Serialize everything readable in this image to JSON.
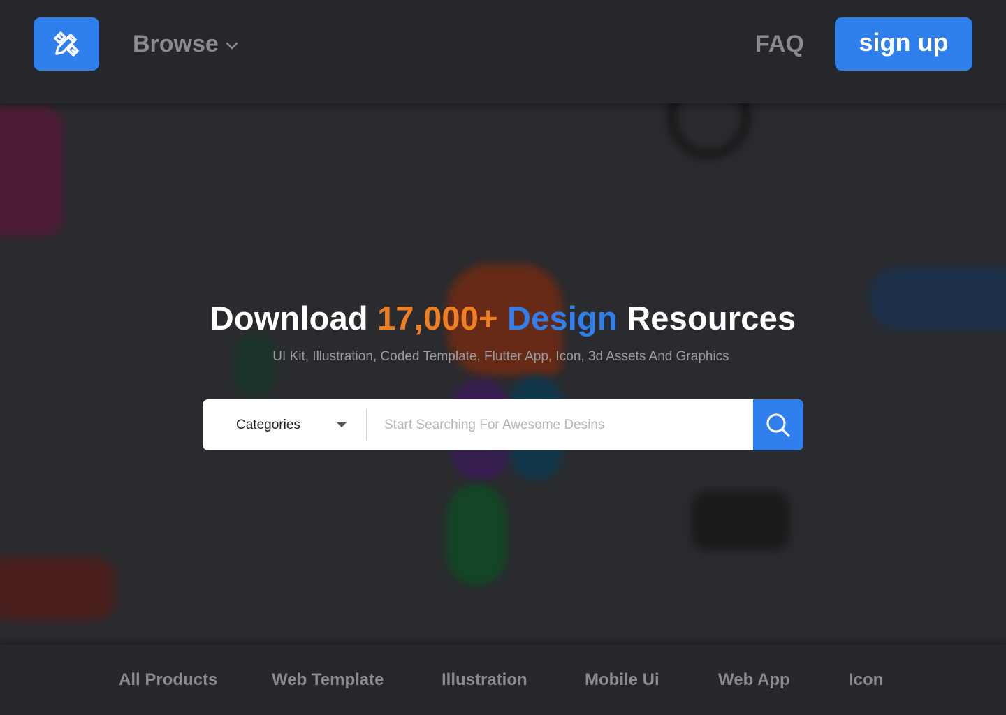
{
  "header": {
    "browse_label": "Browse",
    "faq_label": "FAQ",
    "signup_label": "sign up",
    "logo_icon": "design-tools-icon",
    "accent_color": "#2f80ed"
  },
  "hero": {
    "heading_part1": "Download",
    "heading_count": "17,000+",
    "heading_highlight": "Design",
    "heading_part2": "Resources",
    "subheading": "UI Kit, Illustration, Coded Template, Flutter App, Icon, 3d Assets And Graphics",
    "count_color": "#f07e22",
    "highlight_color": "#2f80ed"
  },
  "search": {
    "category_label": "Categories",
    "placeholder": "Start Searching For Awesome Desins",
    "value": "",
    "button_icon": "search-icon"
  },
  "categories": [
    {
      "label": "All Products"
    },
    {
      "label": "Web Template"
    },
    {
      "label": "Illustration"
    },
    {
      "label": "Mobile Ui"
    },
    {
      "label": "Web App"
    },
    {
      "label": "Icon"
    }
  ]
}
